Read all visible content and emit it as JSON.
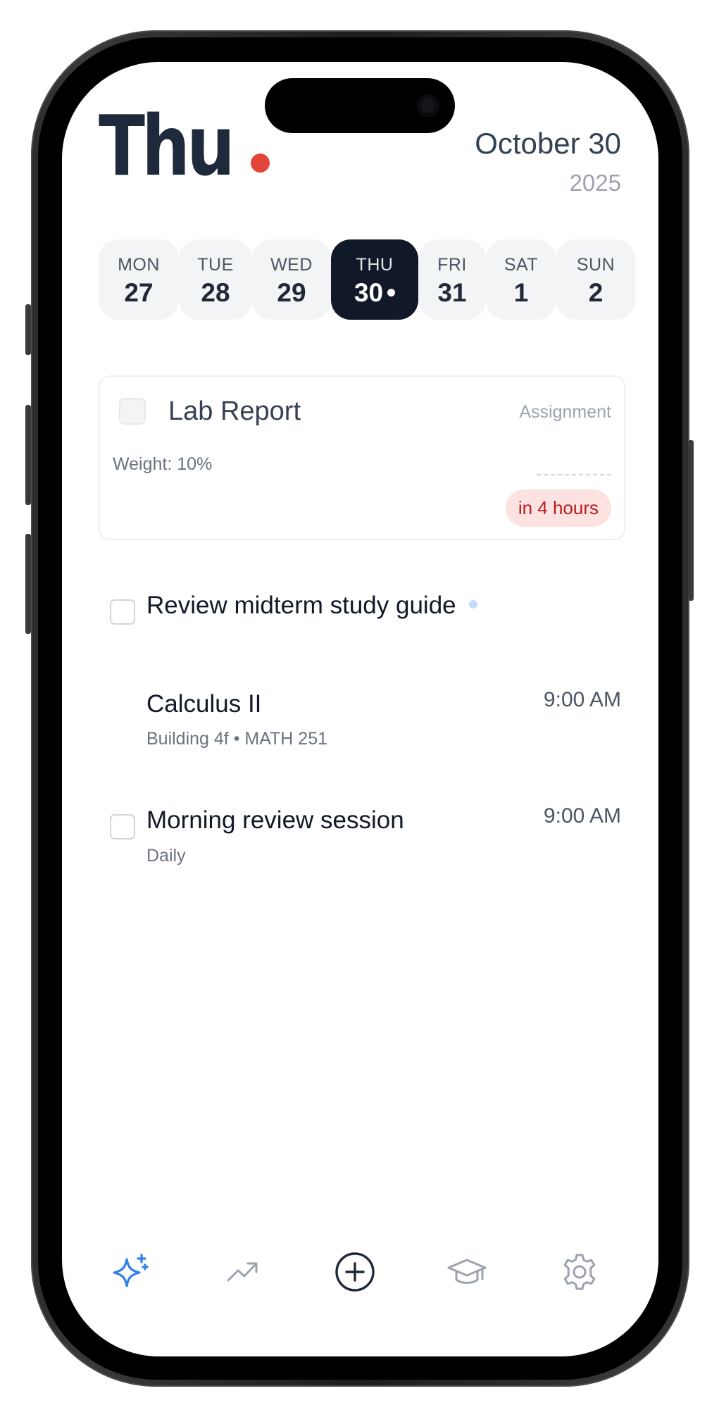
{
  "header": {
    "day_title": "Thu",
    "date": "October 30",
    "year": "2025"
  },
  "week": [
    {
      "name": "MON",
      "date": "27",
      "active": false
    },
    {
      "name": "TUE",
      "date": "28",
      "active": false
    },
    {
      "name": "WED",
      "date": "29",
      "active": false
    },
    {
      "name": "THU",
      "date": "30",
      "active": true
    },
    {
      "name": "FRI",
      "date": "31",
      "active": false
    },
    {
      "name": "SAT",
      "date": "1",
      "active": false
    },
    {
      "name": "SUN",
      "date": "2",
      "active": false
    }
  ],
  "assignment_card": {
    "title": "Lab Report",
    "type": "Assignment",
    "weight": "Weight: 10%",
    "due_badge": "in 4 hours"
  },
  "tasks": [
    {
      "title": "Review midterm study guide"
    },
    {
      "title": "Calculus II",
      "subtitle": "Building 4f • MATH 251",
      "time": "9:00 AM"
    },
    {
      "title": "Morning review session",
      "subtitle": "Daily",
      "time": "9:00 AM"
    }
  ],
  "nav": {
    "items": [
      "sparkles-icon",
      "trending-up-icon",
      "add-circle-icon",
      "graduation-cap-icon",
      "gear-icon"
    ],
    "active_color": "#2f80ed"
  },
  "colors": {
    "accent_red": "#e2463a",
    "active_day": "#111827",
    "badge_bg": "#fde2e2",
    "badge_text": "#b91c1c"
  }
}
